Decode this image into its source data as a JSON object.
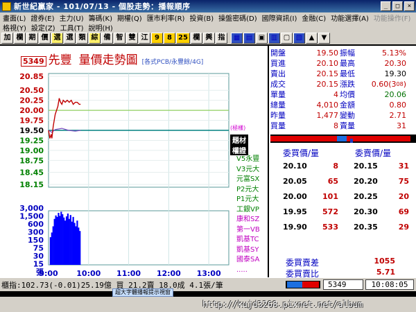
{
  "window": {
    "title": "新世紀贏家 - 101/07/13 - 個股走勢：播報順序",
    "buttons": [
      "_",
      "□",
      "×"
    ]
  },
  "menu1": [
    "畫面(L)",
    "證券(E)",
    "主力(U)",
    "籌碼(K)",
    "期權(Q)",
    "匯市利率(R)",
    "投資(B)",
    "操盤密碼(D)",
    "國際資訊(I)",
    "金融(C)",
    "功能選擇(A)",
    "功能操作(F)"
  ],
  "menu2": [
    "格視(Y)",
    "設定(Z)",
    "工具(T)",
    "說明(H)"
  ],
  "toolbar": [
    "加",
    "欄",
    "期",
    "價",
    "選",
    "選",
    "類",
    "綜",
    "備",
    "智",
    "雙",
    "江",
    "9",
    "8",
    "25",
    "欄",
    "興",
    "指"
  ],
  "chart": {
    "code": "5349",
    "name": "先豐",
    "title": "量價走勢圖",
    "subtitle": "[各式PCB/永豐餘/4G]",
    "price_ticks": [
      "20.85",
      "20.50",
      "20.25",
      "20.00",
      "19.75",
      "19.50",
      "19.25",
      "19.00",
      "18.75",
      "18.45",
      "18.15"
    ],
    "volume_ticks": [
      "3,000",
      "1,500",
      "600",
      "300",
      "150",
      "75",
      "30",
      "15",
      "張"
    ],
    "time_ticks": [
      "9:00",
      "10:00",
      "11:00",
      "12:00",
      "13:00"
    ],
    "tags": {
      "indicator": "(極樣)",
      "topic": "題材",
      "warrant": "權證"
    },
    "brokers": [
      "V5永豐",
      "V3元大",
      "元富SX",
      "P2元大",
      "P1元大",
      "工銀VP",
      "康和SZ",
      "第一VB",
      "凱基TC",
      "凱基SY",
      "國泰SA",
      "....."
    ]
  },
  "chart_data": {
    "type": "line",
    "reference_price": 19.5,
    "price_series": [
      {
        "t": "09:00",
        "p": 19.5
      },
      {
        "t": "09:01",
        "p": 19.4
      },
      {
        "t": "09:02",
        "p": 19.3
      },
      {
        "t": "09:03",
        "p": 19.35
      },
      {
        "t": "09:04",
        "p": 19.4
      },
      {
        "t": "09:05",
        "p": 19.3
      },
      {
        "t": "09:06",
        "p": 19.45
      },
      {
        "t": "09:07",
        "p": 19.6
      },
      {
        "t": "09:08",
        "p": 19.7
      },
      {
        "t": "09:10",
        "p": 19.9
      },
      {
        "t": "09:12",
        "p": 20.0
      },
      {
        "t": "09:14",
        "p": 20.1
      },
      {
        "t": "09:16",
        "p": 20.3
      },
      {
        "t": "09:18",
        "p": 20.2
      },
      {
        "t": "09:20",
        "p": 20.15
      },
      {
        "t": "09:22",
        "p": 20.25
      },
      {
        "t": "09:25",
        "p": 20.2
      },
      {
        "t": "09:28",
        "p": 20.25
      },
      {
        "t": "09:31",
        "p": 20.2
      },
      {
        "t": "09:34",
        "p": 20.25
      },
      {
        "t": "09:37",
        "p": 20.15
      },
      {
        "t": "09:40",
        "p": 20.2
      },
      {
        "t": "09:43",
        "p": 20.2
      },
      {
        "t": "09:46",
        "p": 20.15
      },
      {
        "t": "09:48",
        "p": 20.15
      }
    ],
    "avg_series": [
      {
        "t": "09:00",
        "p": 19.5
      },
      {
        "t": "09:05",
        "p": 19.45
      },
      {
        "t": "09:10",
        "p": 19.52
      },
      {
        "t": "09:20",
        "p": 19.55
      },
      {
        "t": "09:30",
        "p": 19.5
      },
      {
        "t": "09:40",
        "p": 19.48
      },
      {
        "t": "09:48",
        "p": 19.5
      }
    ],
    "volume_bars": [
      {
        "t": "09:03",
        "v": 60
      },
      {
        "t": "09:05",
        "v": 120
      },
      {
        "t": "09:07",
        "v": 300
      },
      {
        "t": "09:09",
        "v": 900
      },
      {
        "t": "09:11",
        "v": 1500
      },
      {
        "t": "09:13",
        "v": 1200
      },
      {
        "t": "09:15",
        "v": 2200
      },
      {
        "t": "09:17",
        "v": 1400
      },
      {
        "t": "09:19",
        "v": 2600
      },
      {
        "t": "09:21",
        "v": 1800
      },
      {
        "t": "09:23",
        "v": 1100
      },
      {
        "t": "09:25",
        "v": 700
      },
      {
        "t": "09:27",
        "v": 1300
      },
      {
        "t": "09:29",
        "v": 2000
      },
      {
        "t": "09:31",
        "v": 900
      },
      {
        "t": "09:33",
        "v": 1600
      },
      {
        "t": "09:35",
        "v": 600
      },
      {
        "t": "09:37",
        "v": 1200
      },
      {
        "t": "09:39",
        "v": 500
      },
      {
        "t": "09:41",
        "v": 300
      },
      {
        "t": "09:43",
        "v": 700
      },
      {
        "t": "09:45",
        "v": 250
      },
      {
        "t": "09:47",
        "v": 150
      }
    ],
    "ylim_price": [
      18.15,
      20.85
    ],
    "colors": {
      "price": "#c00000",
      "avg": "#7a4ac0",
      "volume": "#0000ff",
      "ref_line": "#008080",
      "high_line": "#90d060"
    }
  },
  "quote": {
    "rows": [
      {
        "l1": "開盤",
        "v1": "19.50",
        "c1": "red",
        "l2": "振幅",
        "v2": "5.13%",
        "c2": "red"
      },
      {
        "l1": "買進",
        "v1": "20.10",
        "c1": "red",
        "l2": "最高",
        "v2": "20.30",
        "c2": "red"
      },
      {
        "l1": "賣出",
        "v1": "20.15",
        "c1": "red",
        "l2": "最低",
        "v2": "19.30",
        "c2": "blk"
      },
      {
        "l1": "成交",
        "v1": "20.15",
        "c1": "red",
        "l2": "漲跌",
        "v2": "0.60(3",
        "c2": "red"
      },
      {
        "l1": "單量",
        "v1": "4",
        "c1": "red",
        "l2": "均價",
        "v2": "20.06",
        "c2": "green"
      },
      {
        "l1": "總量",
        "v1": "4,010",
        "c1": "red",
        "l2": "金額",
        "v2": "0.80",
        "c2": "red"
      },
      {
        "l1": "昨量",
        "v1": "1,477",
        "c1": "red",
        "l2": "變動",
        "v2": "2.71",
        "c2": "red"
      },
      {
        "l1": "買量",
        "v1": "8",
        "c1": "red",
        "l2": "賣量",
        "v2": "31",
        "c2": "red"
      }
    ],
    "change_sup": "08",
    "change_close": ")",
    "bid_header": "委買價/量",
    "ask_header": "委賣價/量",
    "orderbook": [
      {
        "bp": "20.10",
        "bv": "8",
        "ap": "20.15",
        "av": "31"
      },
      {
        "bp": "20.05",
        "bv": "65",
        "ap": "20.20",
        "av": "75"
      },
      {
        "bp": "20.00",
        "bv": "101",
        "ap": "20.25",
        "av": "20"
      },
      {
        "bp": "19.95",
        "bv": "572",
        "ap": "20.30",
        "av": "69"
      },
      {
        "bp": "19.90",
        "bv": "533",
        "ap": "20.35",
        "av": "29"
      }
    ],
    "diff_label": "委買賣差",
    "diff_value": "1055",
    "ratio_label": "委買賣比",
    "ratio_value": "5.71"
  },
  "status": {
    "text": "櫃指:102.73(-0.01)25.19億 買 21.2賣 18.0成 4.1張/筆",
    "code": "5349",
    "time": "10:08:05",
    "tip": "超大字體播報提示視窗"
  },
  "watermark": "http://kujd3268.pixnet.net/album"
}
